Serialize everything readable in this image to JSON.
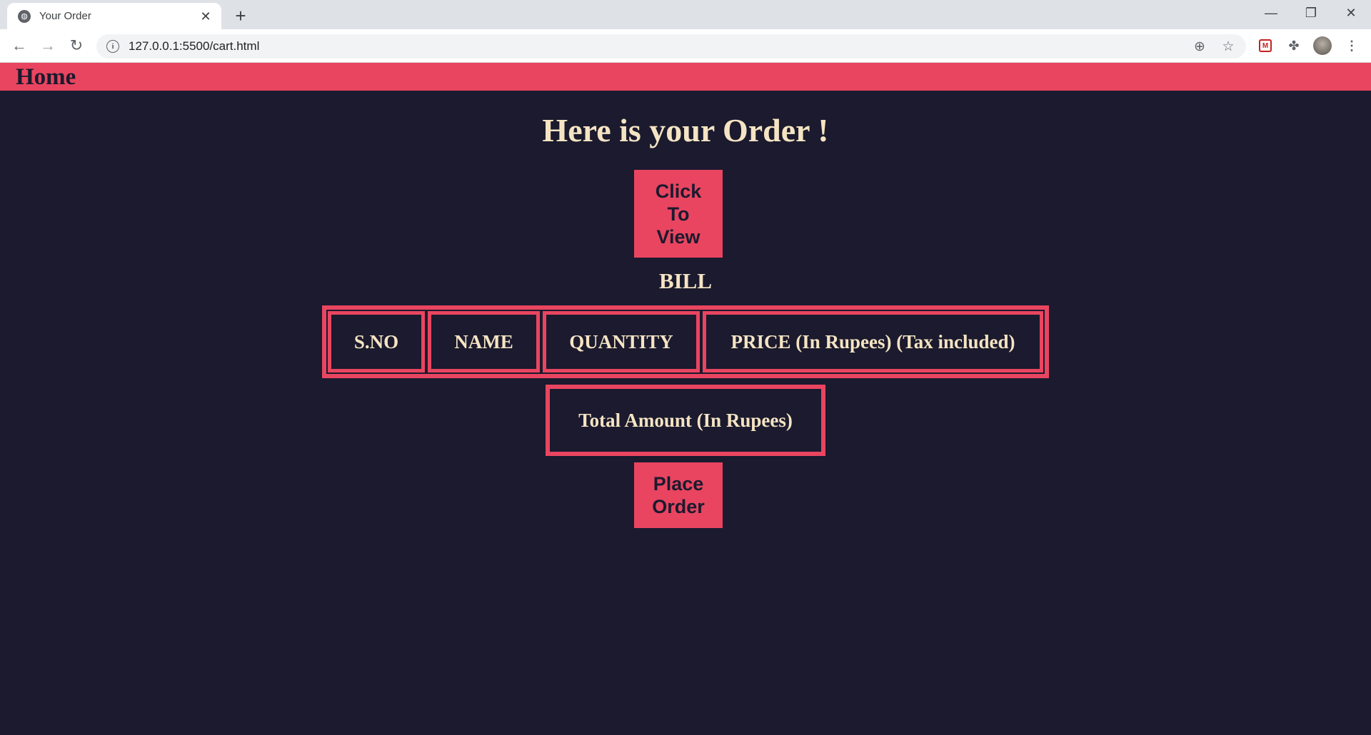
{
  "browser": {
    "tab_title": "Your Order",
    "url": "127.0.0.1:5500/cart.html"
  },
  "navbar": {
    "home_label": "Home"
  },
  "main": {
    "heading": "Here is your Order !",
    "view_button_label": "Click To View",
    "bill_title": "BILL",
    "table_headers": [
      "S.NO",
      "NAME",
      "QUANTITY",
      "PRICE (In Rupees) (Tax included)"
    ],
    "total_label": "Total Amount (In Rupees)",
    "place_order_label": "Place Order"
  },
  "colors": {
    "accent": "#e94560",
    "background": "#1b1a2e",
    "text": "#f5e4c3"
  }
}
